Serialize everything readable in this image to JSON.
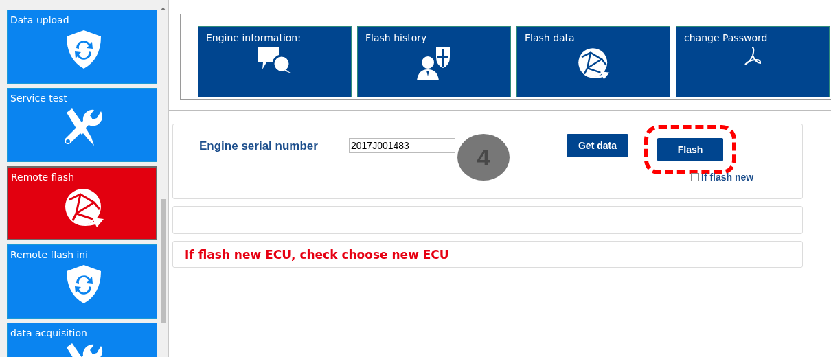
{
  "sidebar": {
    "items": [
      {
        "label": "Data upload",
        "selected": false
      },
      {
        "label": "Service test",
        "selected": false
      },
      {
        "label": "Remote flash",
        "selected": true
      },
      {
        "label": "Remote flash ini",
        "selected": false
      },
      {
        "label": "data acquisition",
        "selected": false
      }
    ]
  },
  "tiles": [
    {
      "label": "Engine information:"
    },
    {
      "label": "Flash history"
    },
    {
      "label": "Flash data"
    },
    {
      "label": "change Password"
    }
  ],
  "form": {
    "label": "Engine serial number",
    "value": "2017J001483",
    "buttons": [
      {
        "label": "Get data",
        "highlighted": false
      },
      {
        "label": "Flash",
        "highlighted": true
      }
    ],
    "checkbox": {
      "label": "If flash new",
      "checked": false
    },
    "step_marker": "4"
  },
  "message": "If flash new ECU, check choose new ECU"
}
